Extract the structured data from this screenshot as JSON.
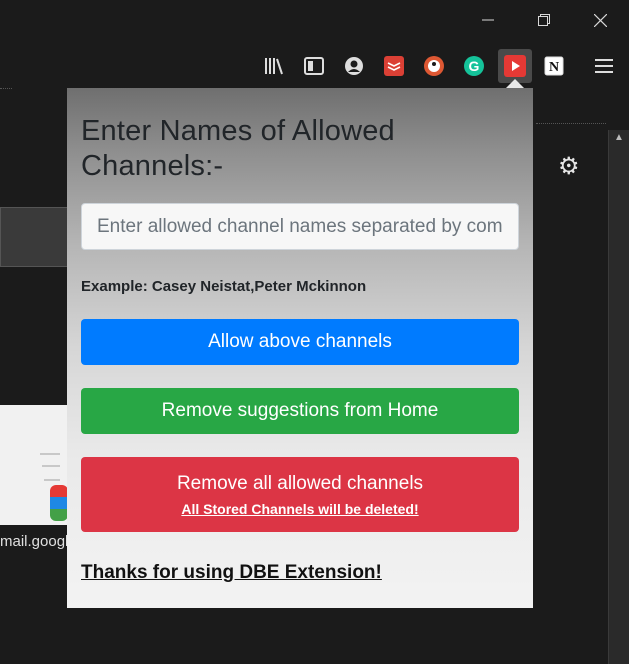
{
  "window": {
    "minimize_icon": "minimize-icon",
    "restore_icon": "restore-icon",
    "close_icon": "close-icon"
  },
  "toolbar": {
    "icons": [
      "library-icon",
      "sidebar-icon",
      "account-icon",
      "todoist-icon",
      "duckduckgo-icon",
      "grammarly-icon",
      "dbe-extension-icon",
      "notion-icon",
      "menu-icon"
    ]
  },
  "background": {
    "url_text": "mail.googl"
  },
  "popup": {
    "title": "Enter Names of Allowed Channels:-",
    "input": {
      "placeholder": "Enter allowed channel names separated by comma",
      "value": ""
    },
    "example": "Example: Casey Neistat,Peter Mckinnon",
    "allow_button": "Allow above channels",
    "remove_suggestions_button": "Remove suggestions from Home",
    "remove_all_button": "Remove all allowed channels",
    "remove_all_warning": "All Stored Channels will be deleted!",
    "thanks": "Thanks for using DBE Extension!"
  },
  "colors": {
    "primary": "#007bff",
    "success": "#28a745",
    "danger": "#dc3545"
  }
}
